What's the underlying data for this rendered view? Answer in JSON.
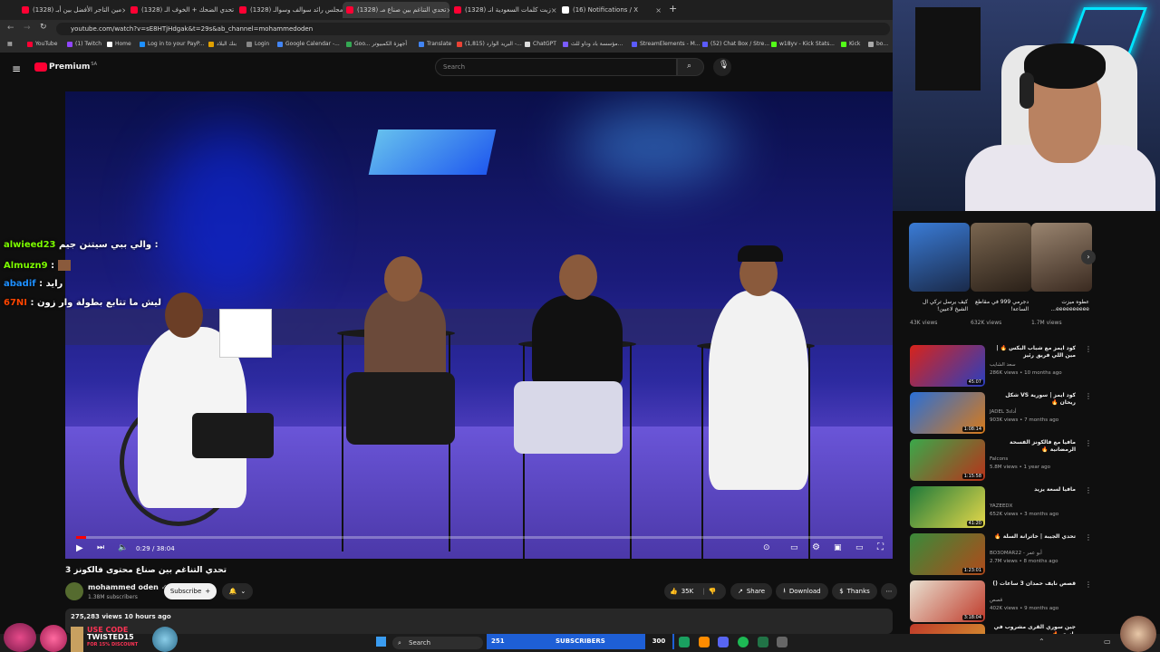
{
  "browser": {
    "tabs": [
      {
        "label": "(1328) مين التاجر الأفضل بين أبـ"
      },
      {
        "label": "(1328) تحدي الضحك + الخوف الـ"
      },
      {
        "label": "(1328) مجلس رائد سوالف وسوالـ"
      },
      {
        "label": "(1328) تحدي التناغم بين صناع مـ"
      },
      {
        "label": "(1328) زبت كلمات السعودية انـ"
      },
      {
        "label": "(16) Notifications / X"
      }
    ],
    "url": "youtube.com/watch?v=sE8HTjHdgak&t=29s&ab_channel=mohammedoden",
    "bookmarks": [
      "YouTube",
      "(1) Twitch",
      "Home",
      "Log in to your PayP...",
      "بنك البلاد",
      "Login",
      "Google Calendar -...",
      "Goo... أجهزة الكمبيوتر",
      "Translate",
      "(1,815) البريد الوارد -...",
      "ChatGPT",
      "مؤسسة باد وداو للث...",
      "StreamElements - M...",
      "(52) Chat Box / Stre...",
      "w18yv - Kick Stats...",
      "Kick",
      "bo..."
    ]
  },
  "youtube": {
    "logo_text": "Premium",
    "logo_region": "SA",
    "search_placeholder": "Search",
    "video": {
      "time": "0:29 / 38:04",
      "progress": 0.0127,
      "title": "تحدي التناغم بين صناع محتوى فالكونز 3",
      "channel": "mohammed oden",
      "subscribers": "1.38M subscribers",
      "subscribe_label": "Subscribe",
      "likes": "35K",
      "share_label": "Share",
      "download_label": "Download",
      "thanks_label": "Thanks",
      "views_line": "275,283 views  10 hours ago"
    },
    "shorts": [
      {
        "title": "كيف يرسل تركي آل الشيخ لاعبين!",
        "views": "43K views"
      },
      {
        "title": "دجرمي 999 في مقاطع الساعة!",
        "views": "632K views"
      },
      {
        "title": "عطوه ميزت eeeeeeeeee...",
        "views": "1.7M views"
      }
    ],
    "recommended": [
      {
        "title": "كود ايمز مع شباب البكس 🔥 | مين اللي فريق رئيز",
        "channel": "سعد الشايب",
        "meta": "286K views • 10 months ago",
        "duration": "45:07"
      },
      {
        "title": "كود ايمز | سورية VS شكل ريحان 🔥",
        "channel": "JADEL 3أداء",
        "meta": "903K views • 7 months ago",
        "duration": "1:08:14"
      },
      {
        "title": "مافيا مع فالكونز الفسحة الرمضانية 🔥",
        "channel": "Falcons",
        "meta": "5.8M views • 1 year ago",
        "duration": "1:15:58"
      },
      {
        "title": "مافيا لسعة يزيد",
        "channel": "YAZEEDX",
        "meta": "652K views • 3 months ago",
        "duration": "41:20"
      },
      {
        "title": "تحدي الجيبة | خاترانة السلة 🔥",
        "channel": "BO3OMAR22 - أبو عمر",
        "meta": "2.7M views • 8 months ago",
        "duration": "1:23:01"
      },
      {
        "title": "قصص نايف حمدان 3 ساعات ()",
        "channel": "قصص",
        "meta": "402K views • 9 months ago",
        "duration": "3:18:04"
      },
      {
        "title": "جبن سوري القرى مشروب في ياتوى 🔥",
        "channel": "",
        "meta": "",
        "duration": ""
      }
    ]
  },
  "stream_overlay": {
    "chat": [
      {
        "user": "alwieed23",
        "text": "والي ببي سيتنن جيم :",
        "color": "#7CFC00"
      },
      {
        "user": "Almuzn9",
        "text": ":",
        "color": "#7CFC00"
      },
      {
        "user": "abadif",
        "text": ": رايد",
        "color": "#1E90FF"
      },
      {
        "user": "67NI",
        "text": ": ليش ما تتابع بطولة وار زون",
        "color": "#FF4500"
      }
    ],
    "promo_line1": "USE CODE",
    "promo_line2": "TWISTED15",
    "promo_line3": "FOR 15% DISCOUNT",
    "subs_count": "251",
    "subs_label": "SUBSCRIBERS",
    "subs_goal": "300"
  },
  "taskbar": {
    "search_label": "Search"
  }
}
